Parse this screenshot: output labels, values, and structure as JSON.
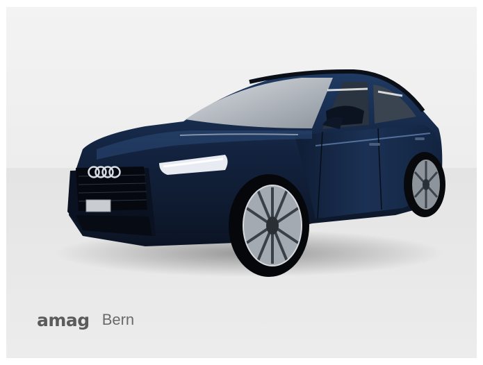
{
  "listing": {
    "image_subject": "car-photo",
    "colors": {
      "body": "#13233f",
      "background": "#eeeeee",
      "brand_text": "#5b5b5b"
    }
  },
  "dealer": {
    "brand": "amag",
    "location": "Bern"
  }
}
